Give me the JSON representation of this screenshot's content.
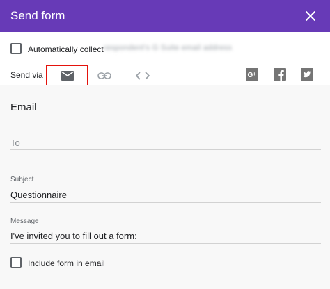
{
  "header": {
    "title": "Send form",
    "close_icon": "close-icon",
    "color": "#673ab7"
  },
  "collect": {
    "label": "Automatically collect",
    "email_blurred": "respondent's G Suite email address"
  },
  "send_via": {
    "label": "Send via",
    "options": [
      {
        "icon": "email-icon",
        "selected": true
      },
      {
        "icon": "link-icon",
        "selected": false
      },
      {
        "icon": "embed-icon",
        "selected": false
      }
    ],
    "social": [
      "google-plus-icon",
      "facebook-icon",
      "twitter-icon"
    ],
    "highlight_color": "#e4130c"
  },
  "email": {
    "title": "Email",
    "to_placeholder": "To",
    "subject_label": "Subject",
    "subject_value": "Questionnaire",
    "message_label": "Message",
    "message_value": "I've invited you to fill out a form:",
    "include_label": "Include form in email"
  }
}
